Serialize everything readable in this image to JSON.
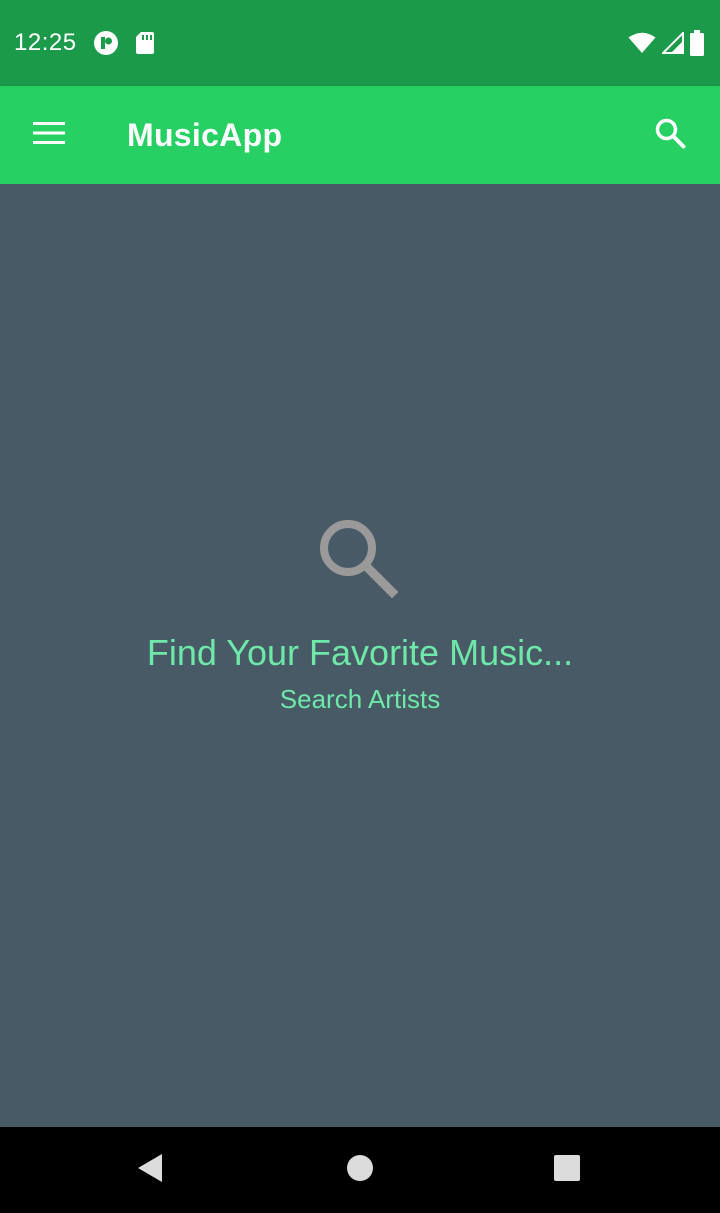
{
  "status_bar": {
    "time": "12:25",
    "icons": [
      "app-notification-icon",
      "sd-card-icon",
      "wifi-icon",
      "cell-signal-icon",
      "battery-icon"
    ]
  },
  "app_bar": {
    "title": "MusicApp",
    "menu_icon": "hamburger-menu-icon",
    "search_icon": "search-icon",
    "background": "#26d062"
  },
  "empty_state": {
    "icon": "search-icon",
    "title": "Find Your Favorite Music...",
    "subtitle": "Search Artists",
    "text_color": "#6ee8a8"
  },
  "nav_bar": {
    "buttons": [
      "back-icon",
      "home-icon",
      "recents-icon"
    ]
  },
  "colors": {
    "status_bar": "#1b9a4a",
    "content_background": "#485a66"
  }
}
